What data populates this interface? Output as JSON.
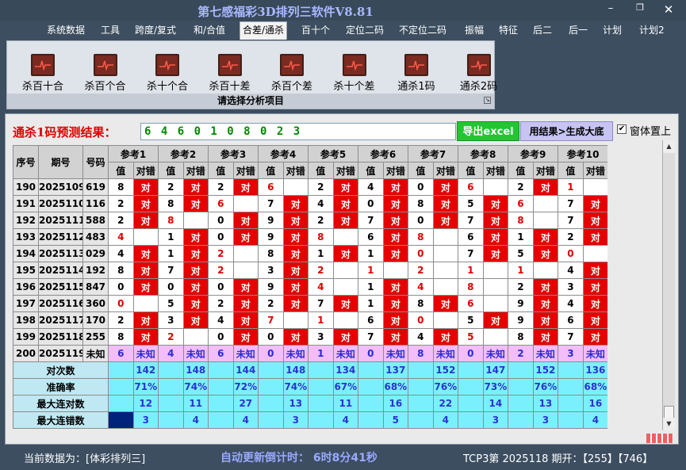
{
  "app": {
    "title": "第七感福彩3D排列三软件V8.81"
  },
  "menu": [
    "系统数据",
    "工具",
    "跨度/复式",
    "和/合值",
    "合差/通杀",
    "百十个",
    "定位二码",
    "不定位二码",
    "振幅",
    "特征",
    "后二",
    "后一",
    "计划",
    "计划2"
  ],
  "menu_active": "合差/通杀",
  "ribbon": {
    "buttons": [
      "杀百十合",
      "杀百个合",
      "杀十个合",
      "杀百十差",
      "杀百个差",
      "杀十个差",
      "通杀1码",
      "通杀2码"
    ],
    "caption": "请选择分析项目"
  },
  "prediction": {
    "label": "通杀1码预测结果：",
    "value": "6 4 6 0 1 0 8 0 2 3",
    "export_label": "导出excel",
    "generate_label": "用结果>生成大底",
    "checkbox_label": "窗体置上",
    "checkbox_checked": true
  },
  "table": {
    "col_headers": [
      "序号",
      "期号",
      "号码"
    ],
    "ref_headers": [
      "参考1",
      "参考2",
      "参考3",
      "参考4",
      "参考5",
      "参考6",
      "参考7",
      "参考8",
      "参考9",
      "参考10"
    ],
    "sub_value": "值",
    "sub_match": "对错",
    "match_text": "对",
    "rows": [
      {
        "seq": "190",
        "issue": "2025109",
        "number": "619",
        "refs": [
          [
            "8",
            "对"
          ],
          [
            "2",
            "对"
          ],
          [
            "2",
            "对"
          ],
          [
            "6",
            ""
          ],
          [
            "2",
            "对"
          ],
          [
            "4",
            "对"
          ],
          [
            "0",
            "对"
          ],
          [
            "6",
            ""
          ],
          [
            "2",
            "对"
          ],
          [
            "1",
            ""
          ]
        ]
      },
      {
        "seq": "191",
        "issue": "2025110",
        "number": "116",
        "refs": [
          [
            "2",
            "对"
          ],
          [
            "8",
            "对"
          ],
          [
            "6",
            ""
          ],
          [
            "7",
            "对"
          ],
          [
            "4",
            "对"
          ],
          [
            "0",
            "对"
          ],
          [
            "8",
            "对"
          ],
          [
            "5",
            "对"
          ],
          [
            "6",
            ""
          ],
          [
            "7",
            "对"
          ]
        ]
      },
      {
        "seq": "192",
        "issue": "2025111",
        "number": "588",
        "refs": [
          [
            "2",
            "对"
          ],
          [
            "8",
            ""
          ],
          [
            "0",
            "对"
          ],
          [
            "9",
            "对"
          ],
          [
            "2",
            "对"
          ],
          [
            "7",
            "对"
          ],
          [
            "0",
            "对"
          ],
          [
            "7",
            "对"
          ],
          [
            "8",
            ""
          ],
          [
            "7",
            "对"
          ]
        ]
      },
      {
        "seq": "193",
        "issue": "2025112",
        "number": "483",
        "refs": [
          [
            "4",
            ""
          ],
          [
            "1",
            "对"
          ],
          [
            "0",
            "对"
          ],
          [
            "9",
            "对"
          ],
          [
            "8",
            ""
          ],
          [
            "6",
            "对"
          ],
          [
            "8",
            ""
          ],
          [
            "6",
            "对"
          ],
          [
            "1",
            "对"
          ],
          [
            "2",
            "对"
          ]
        ]
      },
      {
        "seq": "194",
        "issue": "2025113",
        "number": "029",
        "refs": [
          [
            "4",
            "对"
          ],
          [
            "1",
            "对"
          ],
          [
            "2",
            ""
          ],
          [
            "8",
            "对"
          ],
          [
            "1",
            "对"
          ],
          [
            "1",
            "对"
          ],
          [
            "0",
            ""
          ],
          [
            "7",
            "对"
          ],
          [
            "5",
            "对"
          ],
          [
            "0",
            ""
          ]
        ]
      },
      {
        "seq": "195",
        "issue": "2025114",
        "number": "192",
        "refs": [
          [
            "8",
            "对"
          ],
          [
            "7",
            "对"
          ],
          [
            "2",
            ""
          ],
          [
            "3",
            "对"
          ],
          [
            "2",
            ""
          ],
          [
            "1",
            ""
          ],
          [
            "2",
            ""
          ],
          [
            "1",
            ""
          ],
          [
            "1",
            ""
          ],
          [
            "4",
            "对"
          ]
        ]
      },
      {
        "seq": "196",
        "issue": "2025115",
        "number": "847",
        "refs": [
          [
            "0",
            "对"
          ],
          [
            "0",
            "对"
          ],
          [
            "0",
            "对"
          ],
          [
            "9",
            "对"
          ],
          [
            "4",
            ""
          ],
          [
            "1",
            "对"
          ],
          [
            "4",
            ""
          ],
          [
            "8",
            ""
          ],
          [
            "2",
            "对"
          ],
          [
            "3",
            "对"
          ]
        ]
      },
      {
        "seq": "197",
        "issue": "2025116",
        "number": "360",
        "refs": [
          [
            "0",
            ""
          ],
          [
            "5",
            "对"
          ],
          [
            "2",
            "对"
          ],
          [
            "2",
            "对"
          ],
          [
            "7",
            "对"
          ],
          [
            "1",
            "对"
          ],
          [
            "8",
            "对"
          ],
          [
            "6",
            ""
          ],
          [
            "9",
            "对"
          ],
          [
            "4",
            "对"
          ]
        ]
      },
      {
        "seq": "198",
        "issue": "2025117",
        "number": "170",
        "refs": [
          [
            "2",
            "对"
          ],
          [
            "3",
            "对"
          ],
          [
            "4",
            "对"
          ],
          [
            "7",
            ""
          ],
          [
            "1",
            ""
          ],
          [
            "6",
            "对"
          ],
          [
            "0",
            ""
          ],
          [
            "5",
            "对"
          ],
          [
            "9",
            "对"
          ],
          [
            "6",
            "对"
          ]
        ]
      },
      {
        "seq": "199",
        "issue": "2025118",
        "number": "255",
        "refs": [
          [
            "8",
            "对"
          ],
          [
            "2",
            ""
          ],
          [
            "0",
            "对"
          ],
          [
            "0",
            "对"
          ],
          [
            "3",
            "对"
          ],
          [
            "7",
            "对"
          ],
          [
            "4",
            "对"
          ],
          [
            "5",
            ""
          ],
          [
            "8",
            "对"
          ],
          [
            "7",
            "对"
          ]
        ]
      }
    ],
    "pending": {
      "seq": "200",
      "issue": "2025119",
      "number": "未知",
      "refs": [
        [
          "6",
          "未知"
        ],
        [
          "4",
          "未知"
        ],
        [
          "6",
          "未知"
        ],
        [
          "0",
          "未知"
        ],
        [
          "1",
          "未知"
        ],
        [
          "0",
          "未知"
        ],
        [
          "8",
          "未知"
        ],
        [
          "0",
          "未知"
        ],
        [
          "2",
          "未知"
        ],
        [
          "3",
          "未知"
        ]
      ]
    },
    "stats": [
      {
        "label": "对次数",
        "values": [
          "142",
          "148",
          "144",
          "148",
          "134",
          "137",
          "152",
          "147",
          "152",
          "136"
        ]
      },
      {
        "label": "准确率",
        "values": [
          "71%",
          "74%",
          "72%",
          "74%",
          "67%",
          "68%",
          "76%",
          "73%",
          "76%",
          "68%"
        ]
      },
      {
        "label": "最大连对数",
        "values": [
          "12",
          "11",
          "27",
          "13",
          "11",
          "16",
          "22",
          "14",
          "13",
          "16"
        ]
      },
      {
        "label": "最大连错数",
        "values": [
          "3",
          "4",
          "4",
          "3",
          "4",
          "5",
          "4",
          "3",
          "3",
          "4"
        ]
      }
    ]
  },
  "status": {
    "current": "当前数据为：[体彩排列三]",
    "auto_update": "自动更新倒计时：  6时8分41秒",
    "draw": "TCP3第 2025118 期开：【255】【746】"
  },
  "colors": {
    "hit": "#e60000",
    "miss_value": "#e00000",
    "pending": "#f2bdf8",
    "stats": "#7af0ff",
    "accent": "#22c633"
  }
}
